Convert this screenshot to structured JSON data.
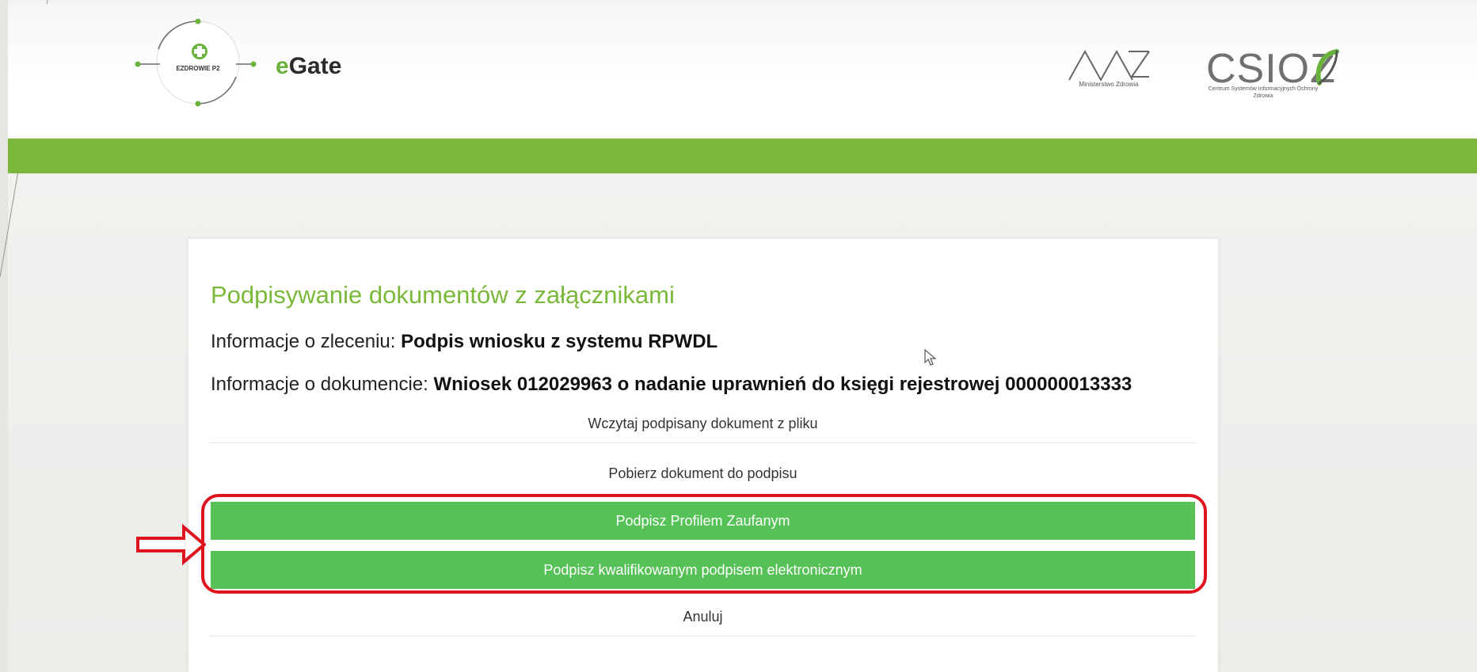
{
  "header": {
    "logo_small_text": "EZDROWIE P2",
    "brand_prefix": "e",
    "brand_name": "Gate",
    "ministry_caption": "Ministerstwo Zdrowia",
    "csioz_logo": "CSIOZ",
    "csioz_caption": "Centrum Systemów Informacyjnych Ochrony Zdrowia"
  },
  "card": {
    "title": "Podpisywanie dokumentów z załącznikami",
    "order_label": "Informacje o zleceniu: ",
    "order_value": "Podpis wniosku z systemu RPWDL",
    "document_label": "Informacje o dokumencie: ",
    "document_value": "Wniosek 012029963 o nadanie uprawnień do księgi rejestrowej 000000013333",
    "actions": {
      "load_signed": "Wczytaj podpisany dokument z pliku",
      "download": "Pobierz dokument do podpisu",
      "sign_profile": "Podpisz Profilem Zaufanym",
      "sign_qualified": "Podpisz kwalifikowanym podpisem elektronicznym",
      "cancel": "Anuluj"
    }
  },
  "colors": {
    "accent_green": "#7ab83a",
    "button_green": "#56c156",
    "highlight_red": "#e0141e"
  }
}
